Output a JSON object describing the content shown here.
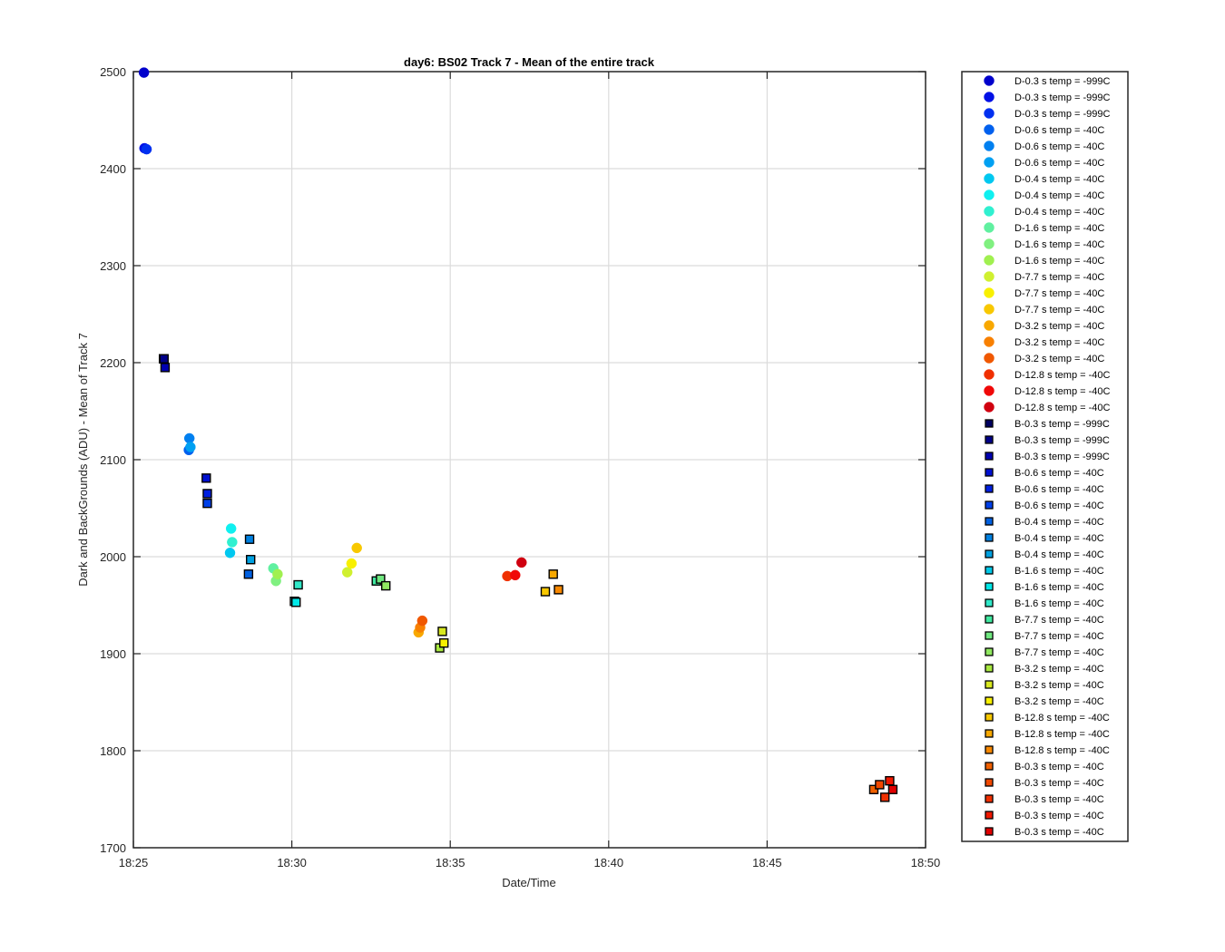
{
  "chart_data": {
    "type": "scatter",
    "title": "day6: BS02  Track 7 - Mean of the entire track",
    "xlabel": "Date/Time",
    "ylabel": "Dark and BackGrounds (ADU) - Mean of Track 7",
    "xlim": [
      "18:25",
      "18:50"
    ],
    "ylim": [
      1700,
      2500
    ],
    "x_ticks": [
      "18:25",
      "18:30",
      "18:35",
      "18:40",
      "18:45",
      "18:50"
    ],
    "y_ticks": [
      1700,
      1800,
      1900,
      2000,
      2100,
      2200,
      2300,
      2400,
      2500
    ],
    "grid": true,
    "legend_position": "outside-right",
    "series": [
      {
        "name": "D-0.3 s temp = -999C",
        "marker": "circle",
        "color": "#0000cc",
        "points": [
          [
            "18:25:20",
            2499
          ]
        ]
      },
      {
        "name": "D-0.3 s temp = -999C",
        "marker": "circle",
        "color": "#0010e6",
        "points": [
          [
            "18:25:21",
            2421
          ]
        ]
      },
      {
        "name": "D-0.3 s temp = -999C",
        "marker": "circle",
        "color": "#0030f0",
        "points": [
          [
            "18:25:25",
            2420
          ]
        ]
      },
      {
        "name": "D-0.6 s temp = -40C",
        "marker": "circle",
        "color": "#0060ee",
        "points": [
          [
            "18:26:45",
            2110
          ]
        ]
      },
      {
        "name": "D-0.6 s temp = -40C",
        "marker": "circle",
        "color": "#0080f0",
        "points": [
          [
            "18:26:46",
            2122
          ]
        ]
      },
      {
        "name": "D-0.6 s temp = -40C",
        "marker": "circle",
        "color": "#00a0f2",
        "points": [
          [
            "18:26:48",
            2113
          ]
        ]
      },
      {
        "name": "D-0.4 s temp = -40C",
        "marker": "circle",
        "color": "#00c8f0",
        "points": [
          [
            "18:28:03",
            2004
          ]
        ]
      },
      {
        "name": "D-0.4 s temp = -40C",
        "marker": "circle",
        "color": "#10f0f0",
        "points": [
          [
            "18:28:05",
            2029
          ]
        ]
      },
      {
        "name": "D-0.4 s temp = -40C",
        "marker": "circle",
        "color": "#30f0d0",
        "points": [
          [
            "18:28:07",
            2015
          ]
        ]
      },
      {
        "name": "D-1.6 s temp = -40C",
        "marker": "circle",
        "color": "#60f0a0",
        "points": [
          [
            "18:29:25",
            1988
          ]
        ]
      },
      {
        "name": "D-1.6 s temp = -40C",
        "marker": "circle",
        "color": "#80f080",
        "points": [
          [
            "18:29:30",
            1975
          ]
        ]
      },
      {
        "name": "D-1.6 s temp = -40C",
        "marker": "circle",
        "color": "#a0f050",
        "points": [
          [
            "18:29:33",
            1982
          ]
        ]
      },
      {
        "name": "D-7.7 s temp = -40C",
        "marker": "circle",
        "color": "#d0f030",
        "points": [
          [
            "18:31:45",
            1984
          ]
        ]
      },
      {
        "name": "D-7.7 s temp = -40C",
        "marker": "circle",
        "color": "#f8f000",
        "points": [
          [
            "18:31:53",
            1993
          ]
        ]
      },
      {
        "name": "D-7.7 s temp = -40C",
        "marker": "circle",
        "color": "#f8c800",
        "points": [
          [
            "18:32:03",
            2009
          ]
        ]
      },
      {
        "name": "D-3.2 s temp = -40C",
        "marker": "circle",
        "color": "#f8a800",
        "points": [
          [
            "18:34:00",
            1922
          ]
        ]
      },
      {
        "name": "D-3.2 s temp = -40C",
        "marker": "circle",
        "color": "#f88000",
        "points": [
          [
            "18:34:03",
            1927
          ]
        ]
      },
      {
        "name": "D-3.2 s temp = -40C",
        "marker": "circle",
        "color": "#f05800",
        "points": [
          [
            "18:34:07",
            1934
          ]
        ]
      },
      {
        "name": "D-12.8 s temp = -40C",
        "marker": "circle",
        "color": "#f03000",
        "points": [
          [
            "18:36:48",
            1980
          ]
        ]
      },
      {
        "name": "D-12.8 s temp = -40C",
        "marker": "circle",
        "color": "#f00808",
        "points": [
          [
            "18:37:03",
            1981
          ]
        ]
      },
      {
        "name": "D-12.8 s temp = -40C",
        "marker": "circle",
        "color": "#d00010",
        "points": [
          [
            "18:37:15",
            1994
          ]
        ]
      },
      {
        "name": "B-0.3 s temp = -999C",
        "marker": "square",
        "color": "#000060",
        "points": [
          [
            "18:25:57",
            2204
          ]
        ]
      },
      {
        "name": "B-0.3 s temp = -999C",
        "marker": "square",
        "color": "#000088",
        "points": [
          [
            "18:25:58",
            2204
          ]
        ]
      },
      {
        "name": "B-0.3 s temp = -999C",
        "marker": "square",
        "color": "#0000b0",
        "points": [
          [
            "18:26:00",
            2195
          ]
        ]
      },
      {
        "name": "B-0.6 s temp = -40C",
        "marker": "square",
        "color": "#0010d0",
        "points": [
          [
            "18:27:18",
            2081
          ]
        ]
      },
      {
        "name": "B-0.6 s temp = -40C",
        "marker": "square",
        "color": "#0020e0",
        "points": [
          [
            "18:27:20",
            2065
          ]
        ]
      },
      {
        "name": "B-0.6 s temp = -40C",
        "marker": "square",
        "color": "#0040e8",
        "points": [
          [
            "18:27:20",
            2055
          ]
        ]
      },
      {
        "name": "B-0.4 s temp = -40C",
        "marker": "square",
        "color": "#0060e0",
        "points": [
          [
            "18:28:38",
            1982
          ]
        ]
      },
      {
        "name": "B-0.4 s temp = -40C",
        "marker": "square",
        "color": "#0080e0",
        "points": [
          [
            "18:28:40",
            2018
          ]
        ]
      },
      {
        "name": "B-0.4 s temp = -40C",
        "marker": "square",
        "color": "#00a0e0",
        "points": [
          [
            "18:28:42",
            1997
          ]
        ]
      },
      {
        "name": "B-1.6 s temp = -40C",
        "marker": "square",
        "color": "#00c8e8",
        "points": [
          [
            "18:30:05",
            1954
          ]
        ]
      },
      {
        "name": "B-1.6 s temp = -40C",
        "marker": "square",
        "color": "#00e8e8",
        "points": [
          [
            "18:30:08",
            1953
          ]
        ]
      },
      {
        "name": "B-1.6 s temp = -40C",
        "marker": "square",
        "color": "#30e8c8",
        "points": [
          [
            "18:30:12",
            1971
          ]
        ]
      },
      {
        "name": "B-7.7 s temp = -40C",
        "marker": "square",
        "color": "#40e8a0",
        "points": [
          [
            "18:32:40",
            1975
          ]
        ]
      },
      {
        "name": "B-7.7 s temp = -40C",
        "marker": "square",
        "color": "#70e880",
        "points": [
          [
            "18:32:48",
            1977
          ]
        ]
      },
      {
        "name": "B-7.7 s temp = -40C",
        "marker": "square",
        "color": "#90e860",
        "points": [
          [
            "18:32:58",
            1970
          ]
        ]
      },
      {
        "name": "B-3.2 s temp = -40C",
        "marker": "square",
        "color": "#a8e840",
        "points": [
          [
            "18:34:40",
            1906
          ]
        ]
      },
      {
        "name": "B-3.2 s temp = -40C",
        "marker": "square",
        "color": "#d8e820",
        "points": [
          [
            "18:34:45",
            1923
          ]
        ]
      },
      {
        "name": "B-3.2 s temp = -40C",
        "marker": "square",
        "color": "#f8f000",
        "points": [
          [
            "18:34:48",
            1911
          ]
        ]
      },
      {
        "name": "B-12.8 s temp = -40C",
        "marker": "square",
        "color": "#f8c800",
        "points": [
          [
            "18:38:00",
            1964
          ]
        ]
      },
      {
        "name": "B-12.8 s temp = -40C",
        "marker": "square",
        "color": "#f8a800",
        "points": [
          [
            "18:38:15",
            1982
          ]
        ]
      },
      {
        "name": "B-12.8 s temp = -40C",
        "marker": "square",
        "color": "#f88800",
        "points": [
          [
            "18:38:25",
            1966
          ]
        ]
      },
      {
        "name": "B-0.3 s temp = -40C",
        "marker": "square",
        "color": "#f06000",
        "points": [
          [
            "18:48:22",
            1760
          ]
        ]
      },
      {
        "name": "B-0.3 s temp = -40C",
        "marker": "square",
        "color": "#f04800",
        "points": [
          [
            "18:48:33",
            1765
          ]
        ]
      },
      {
        "name": "B-0.3 s temp = -40C",
        "marker": "square",
        "color": "#f03000",
        "points": [
          [
            "18:48:43",
            1752
          ]
        ]
      },
      {
        "name": "B-0.3 s temp = -40C",
        "marker": "square",
        "color": "#f01800",
        "points": [
          [
            "18:48:52",
            1769
          ]
        ]
      },
      {
        "name": "B-0.3 s temp = -40C",
        "marker": "square",
        "color": "#e00000",
        "points": [
          [
            "18:48:58",
            1760
          ]
        ]
      }
    ]
  }
}
